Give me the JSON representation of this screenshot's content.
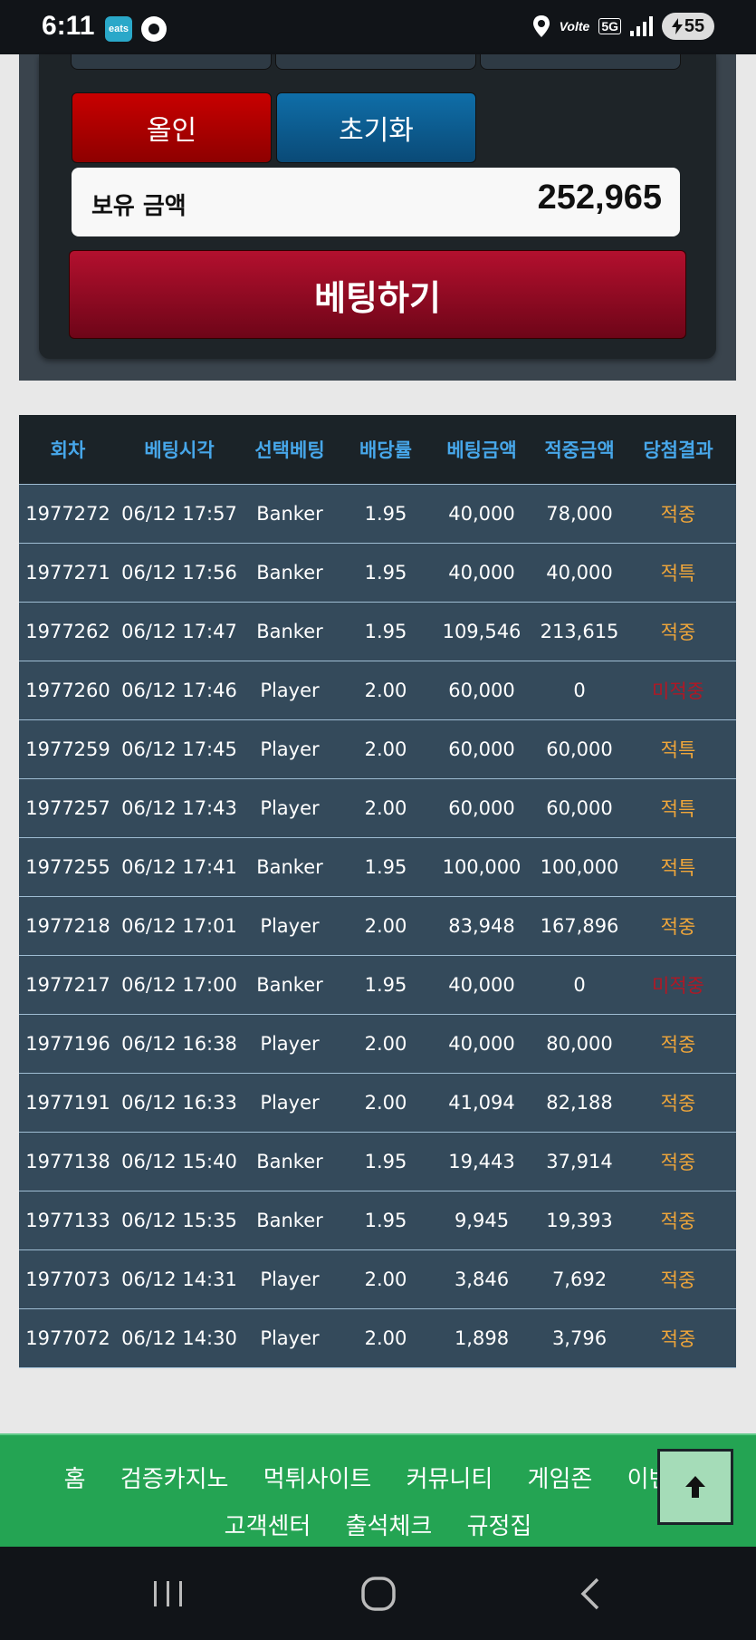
{
  "status_bar": {
    "time": "6:11",
    "eats_label": "eats",
    "volte": "Volte",
    "network": "5G",
    "battery": "55"
  },
  "panel": {
    "allin_label": "올인",
    "reset_label": "초기화",
    "balance_label": "보유 금액",
    "balance_value": "252,965",
    "bet_label": "베팅하기"
  },
  "table": {
    "headers": [
      "회차",
      "베팅시각",
      "선택베팅",
      "배당률",
      "베팅금액",
      "적중금액",
      "당첨결과"
    ],
    "rows": [
      {
        "round": "1977272",
        "time": "06/12 17:57",
        "pick": "Banker",
        "odds": "1.95",
        "bet": "40,000",
        "win": "78,000",
        "result": "적중",
        "status": "win"
      },
      {
        "round": "1977271",
        "time": "06/12 17:56",
        "pick": "Banker",
        "odds": "1.95",
        "bet": "40,000",
        "win": "40,000",
        "result": "적특",
        "status": "win"
      },
      {
        "round": "1977262",
        "time": "06/12 17:47",
        "pick": "Banker",
        "odds": "1.95",
        "bet": "109,546",
        "win": "213,615",
        "result": "적중",
        "status": "win"
      },
      {
        "round": "1977260",
        "time": "06/12 17:46",
        "pick": "Player",
        "odds": "2.00",
        "bet": "60,000",
        "win": "0",
        "result": "미적중",
        "status": "lose"
      },
      {
        "round": "1977259",
        "time": "06/12 17:45",
        "pick": "Player",
        "odds": "2.00",
        "bet": "60,000",
        "win": "60,000",
        "result": "적특",
        "status": "win"
      },
      {
        "round": "1977257",
        "time": "06/12 17:43",
        "pick": "Player",
        "odds": "2.00",
        "bet": "60,000",
        "win": "60,000",
        "result": "적특",
        "status": "win"
      },
      {
        "round": "1977255",
        "time": "06/12 17:41",
        "pick": "Banker",
        "odds": "1.95",
        "bet": "100,000",
        "win": "100,000",
        "result": "적특",
        "status": "win"
      },
      {
        "round": "1977218",
        "time": "06/12 17:01",
        "pick": "Player",
        "odds": "2.00",
        "bet": "83,948",
        "win": "167,896",
        "result": "적중",
        "status": "win"
      },
      {
        "round": "1977217",
        "time": "06/12 17:00",
        "pick": "Banker",
        "odds": "1.95",
        "bet": "40,000",
        "win": "0",
        "result": "미적중",
        "status": "lose"
      },
      {
        "round": "1977196",
        "time": "06/12 16:38",
        "pick": "Player",
        "odds": "2.00",
        "bet": "40,000",
        "win": "80,000",
        "result": "적중",
        "status": "win"
      },
      {
        "round": "1977191",
        "time": "06/12 16:33",
        "pick": "Player",
        "odds": "2.00",
        "bet": "41,094",
        "win": "82,188",
        "result": "적중",
        "status": "win"
      },
      {
        "round": "1977138",
        "time": "06/12 15:40",
        "pick": "Banker",
        "odds": "1.95",
        "bet": "19,443",
        "win": "37,914",
        "result": "적중",
        "status": "win"
      },
      {
        "round": "1977133",
        "time": "06/12 15:35",
        "pick": "Banker",
        "odds": "1.95",
        "bet": "9,945",
        "win": "19,393",
        "result": "적중",
        "status": "win"
      },
      {
        "round": "1977073",
        "time": "06/12 14:31",
        "pick": "Player",
        "odds": "2.00",
        "bet": "3,846",
        "win": "7,692",
        "result": "적중",
        "status": "win"
      },
      {
        "round": "1977072",
        "time": "06/12 14:30",
        "pick": "Player",
        "odds": "2.00",
        "bet": "1,898",
        "win": "3,796",
        "result": "적중",
        "status": "win"
      }
    ]
  },
  "footer": {
    "nav_row1": [
      "홈",
      "검증카지노",
      "먹튀사이트",
      "커뮤니티",
      "게임존",
      "이벤트"
    ],
    "nav_row2": [
      "고객센터",
      "출석체크",
      "규정집"
    ]
  },
  "colors": {
    "win": "#f0a63a",
    "lose": "#b01825",
    "header_text": "#47a7ea",
    "footer_bg": "#24a453"
  },
  "icons": {
    "scroll_top": "arrow-up-icon",
    "recent_apps": "recent-apps-icon",
    "home": "home-circle-icon",
    "back": "back-chevron-icon"
  }
}
